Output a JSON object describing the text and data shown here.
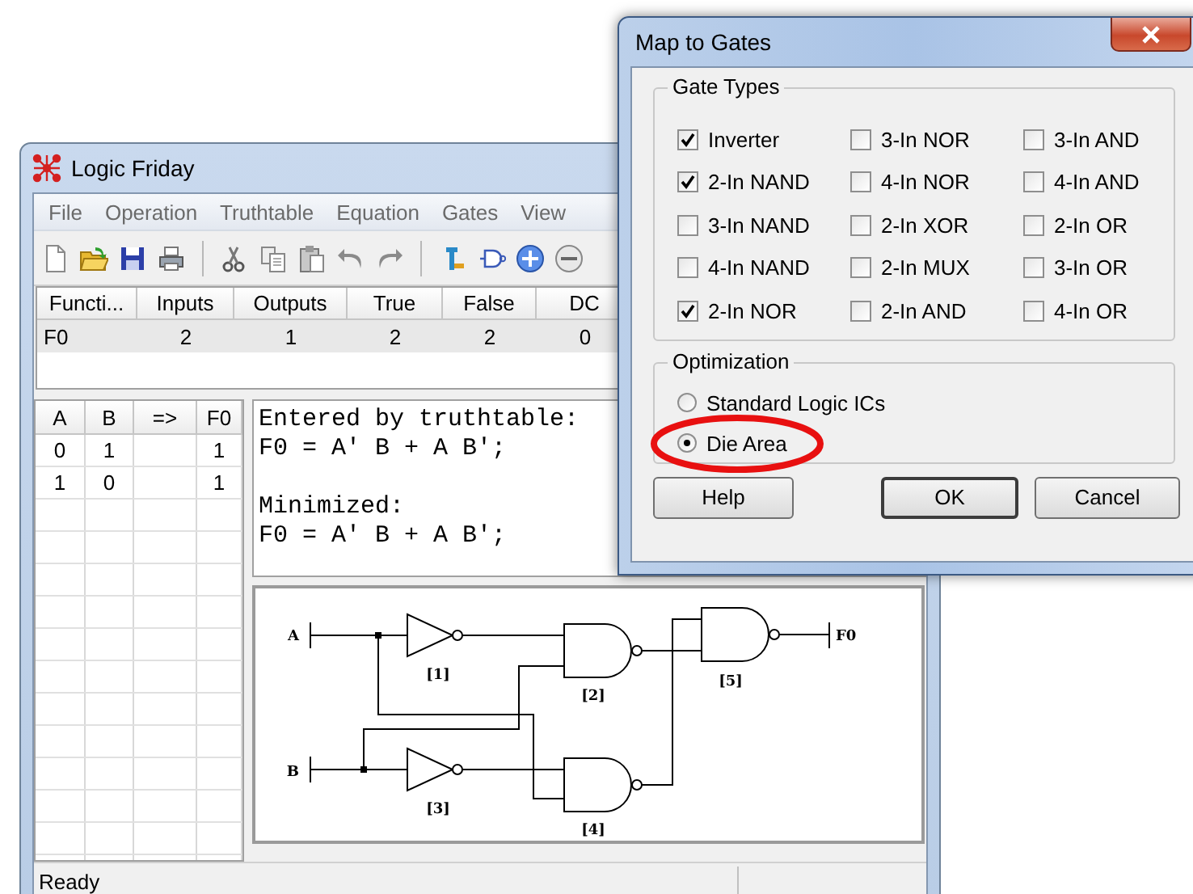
{
  "main_window": {
    "title": "Logic Friday",
    "menu": [
      "File",
      "Operation",
      "Truthtable",
      "Equation",
      "Gates",
      "View"
    ],
    "function_table": {
      "columns": [
        "Functi...",
        "Inputs",
        "Outputs",
        "True",
        "False",
        "DC"
      ],
      "rows": [
        {
          "cells": [
            "F0",
            "2",
            "1",
            "2",
            "2",
            "0"
          ],
          "selected": true
        }
      ]
    },
    "truth_table": {
      "columns": [
        "A",
        "B",
        "=>",
        "F0"
      ],
      "rows": [
        {
          "inputs": [
            "0",
            "1"
          ],
          "outputs": [
            "1"
          ]
        },
        {
          "inputs": [
            "1",
            "0"
          ],
          "outputs": [
            "1"
          ]
        }
      ]
    },
    "equations": [
      [
        "Entered by truthtable:",
        "F0 = A' B + A B';"
      ],
      [
        "Minimized:",
        "F0 = A' B + A B';"
      ]
    ],
    "circuit": {
      "inputs": [
        "A",
        "B"
      ],
      "output": "F0",
      "gates": [
        {
          "kind": "inverter",
          "label": "[1]"
        },
        {
          "kind": "nand",
          "label": "[2]"
        },
        {
          "kind": "inverter",
          "label": "[3]"
        },
        {
          "kind": "nand",
          "label": "[4]"
        },
        {
          "kind": "nand",
          "label": "[5]"
        }
      ]
    },
    "status_bar": {
      "text": "Ready"
    }
  },
  "dialog": {
    "title": "Map to Gates",
    "gate_types": {
      "title": "Gate Types",
      "options": [
        {
          "label": "Inverter",
          "checked": true
        },
        {
          "label": "3-In NOR",
          "checked": false
        },
        {
          "label": "3-In AND",
          "checked": false
        },
        {
          "label": "2-In NAND",
          "checked": true
        },
        {
          "label": "4-In NOR",
          "checked": false
        },
        {
          "label": "4-In AND",
          "checked": false
        },
        {
          "label": "3-In NAND",
          "checked": false
        },
        {
          "label": "2-In XOR",
          "checked": false
        },
        {
          "label": "2-In OR",
          "checked": false
        },
        {
          "label": "4-In NAND",
          "checked": false
        },
        {
          "label": "2-In MUX",
          "checked": false
        },
        {
          "label": "3-In OR",
          "checked": false
        },
        {
          "label": "2-In NOR",
          "checked": true
        },
        {
          "label": "2-In AND",
          "checked": false
        },
        {
          "label": "4-In OR",
          "checked": false
        }
      ]
    },
    "optimization": {
      "title": "Optimization",
      "options": [
        {
          "label": "Standard Logic ICs",
          "selected": false,
          "highlighted": false
        },
        {
          "label": "Die Area",
          "selected": true,
          "highlighted": true
        }
      ]
    },
    "buttons": [
      {
        "label": "Help",
        "default": false
      },
      {
        "label": "OK",
        "default": true
      },
      {
        "label": "Cancel",
        "default": false
      }
    ]
  }
}
